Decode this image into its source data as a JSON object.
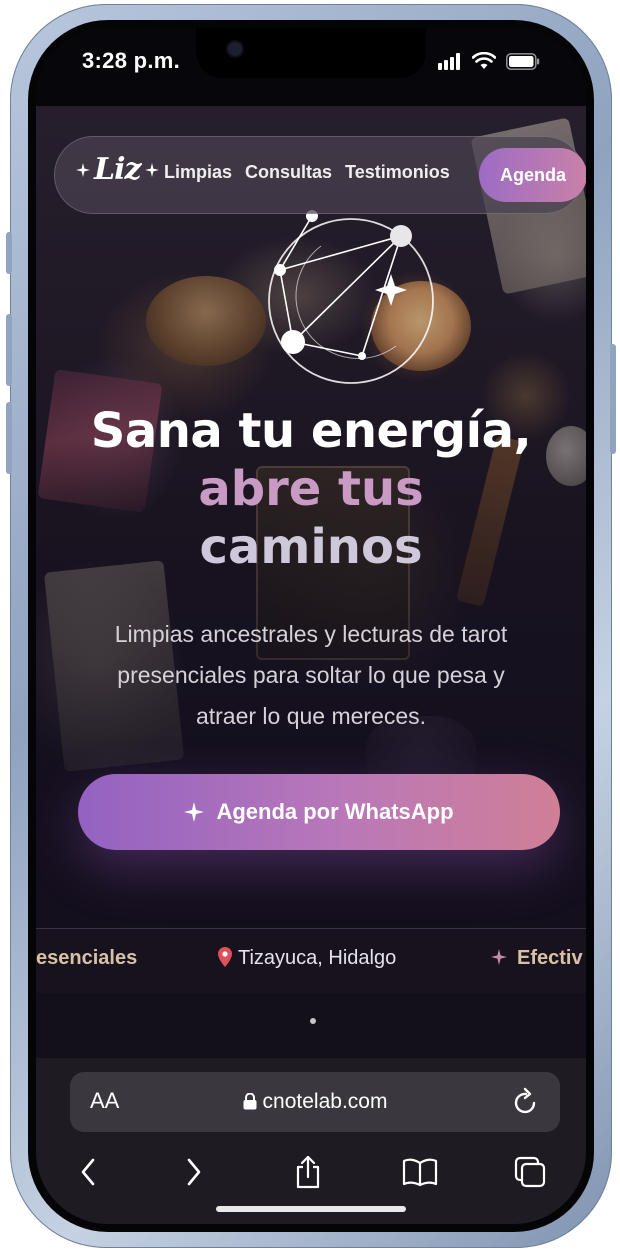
{
  "status_bar": {
    "time": "3:28 p.m."
  },
  "nav": {
    "logo": "Liz",
    "links": [
      "Limpias",
      "Consultas",
      "Testimonios"
    ],
    "cta": "Agenda"
  },
  "hero": {
    "headline_line1": "Sana tu energía,",
    "headline_line2": "abre tus",
    "headline_line3": "caminos",
    "subtitle": "Limpias ancestrales y lecturas de tarot presenciales para soltar lo que pesa y atraer lo que mereces.",
    "cta_label": "Agenda por WhatsApp",
    "cta_icon": "sparkle-icon"
  },
  "marquee": {
    "items": [
      {
        "text": "esenciales",
        "icon": ""
      },
      {
        "text": "Tizayuca, Hidalgo",
        "icon": "pin-icon"
      },
      {
        "text": "Efectiv",
        "icon": "sparkle-icon"
      }
    ]
  },
  "browser": {
    "text_size_label": "AA",
    "url": "cnotelab.com"
  },
  "colors": {
    "accent_start": "#9362c2",
    "accent_end": "#d07f95",
    "headline_pink": "#c99bc4",
    "marquee_text": "#d8c2a5"
  }
}
